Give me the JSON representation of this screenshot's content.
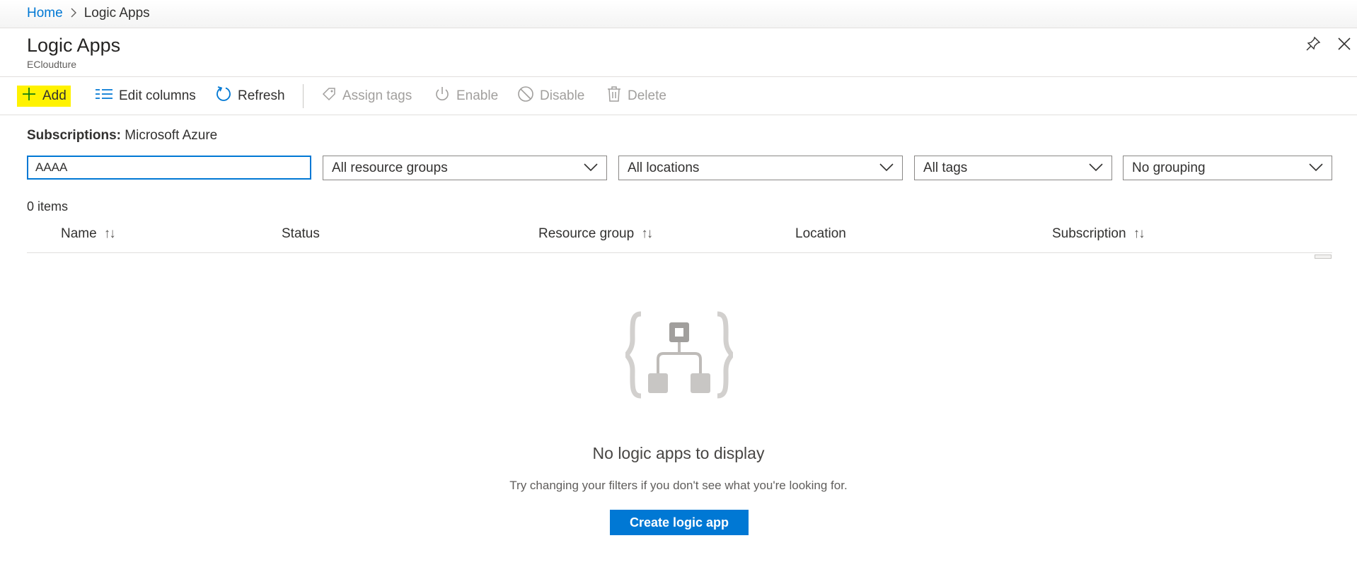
{
  "breadcrumb": {
    "home": "Home",
    "separator": ">",
    "current": "Logic Apps"
  },
  "header": {
    "title": "Logic Apps",
    "subtitle": "ECloudture"
  },
  "toolbar": {
    "add": "Add",
    "edit_columns": "Edit columns",
    "refresh": "Refresh",
    "assign_tags": "Assign tags",
    "enable": "Enable",
    "disable": "Disable",
    "delete": "Delete"
  },
  "filters": {
    "subscriptions_label": "Subscriptions:",
    "subscriptions_value": "Microsoft Azure",
    "search_value": "AAAA",
    "resource_groups": "All resource groups",
    "locations": "All locations",
    "tags": "All tags",
    "grouping": "No grouping"
  },
  "table": {
    "count": "0 items",
    "columns": [
      "Name",
      "Status",
      "Resource group",
      "Location",
      "Subscription"
    ]
  },
  "empty": {
    "title": "No logic apps to display",
    "description": "Try changing your filters if you don't see what you're looking for.",
    "button": "Create logic app"
  },
  "colors": {
    "accent": "#0078d4",
    "highlight": "#fff200",
    "disabled": "#a19f9d"
  },
  "icons": [
    "chevron-right-icon",
    "pin-icon",
    "close-icon",
    "plus-icon",
    "edit-columns-icon",
    "refresh-icon",
    "tag-icon",
    "power-icon",
    "disable-icon",
    "trash-icon",
    "chevron-down-icon",
    "sort-icon",
    "logic-app-icon"
  ]
}
